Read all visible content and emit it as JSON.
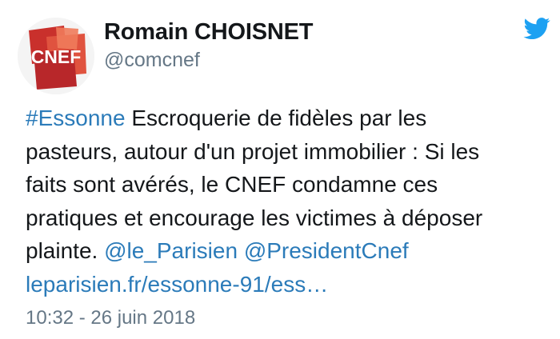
{
  "author": {
    "name": "Romain CHOISNET",
    "handle": "@comcnef",
    "avatar_logo_text": "CNEF"
  },
  "tweet": {
    "hashtag": "#Essonne",
    "line1_rest": " Escroquerie de fidèles par les",
    "line2": "pasteurs, autour d'un projet immobilier : Si les",
    "line3": "faits sont avérés, le CNEF condamne ces",
    "line4": "pratiques et encourage les victimes à déposer",
    "line5_text": "plainte. ",
    "mention1": "@le_Parisien",
    "mention2": "@PresidentCnef",
    "link": "leparisien.fr/essonne-91/ess…",
    "timestamp": "10:32 - 26 juin 2018"
  },
  "colors": {
    "link": "#2b7bb9",
    "handle": "#657786",
    "twitter_blue": "#1da1f2",
    "logo_red": "#d9473a"
  },
  "icons": {
    "brand": "twitter-bird-icon",
    "avatar": "cnef-logo"
  }
}
